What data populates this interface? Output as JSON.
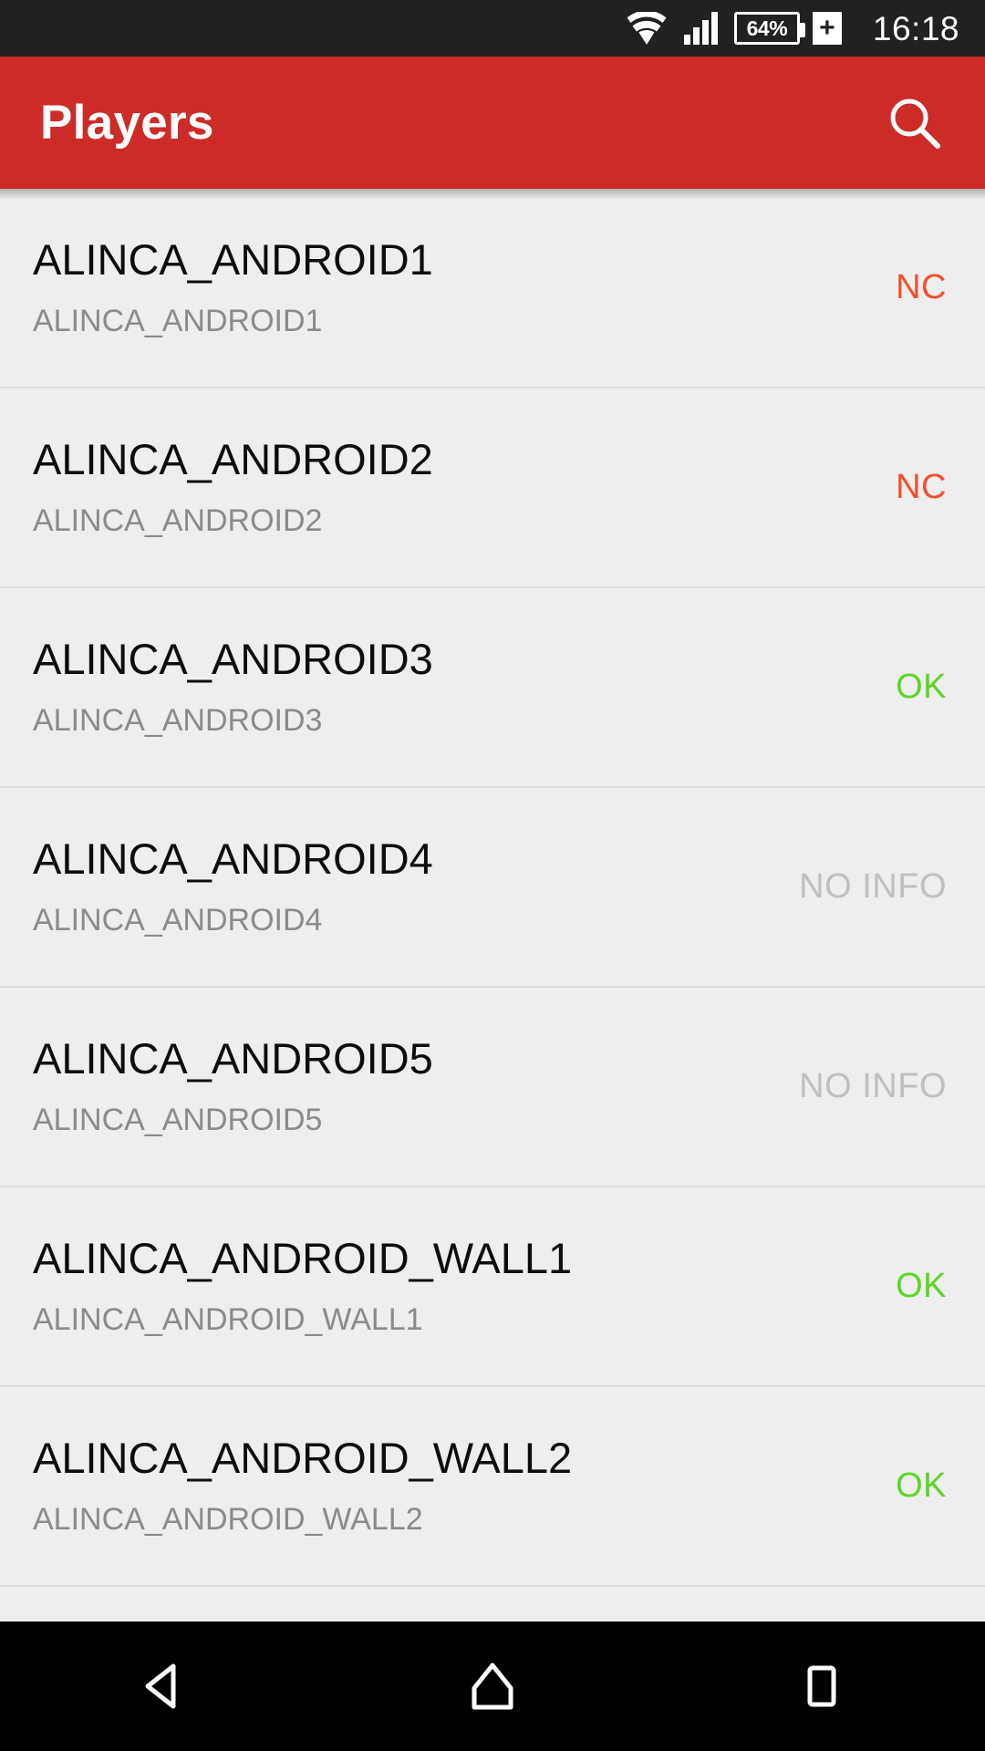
{
  "status_bar": {
    "wifi_icon": "wifi-icon",
    "signal_icon": "cellular-signal-icon",
    "battery_percent": "64%",
    "battery_plus": "+",
    "time": "16:18"
  },
  "app_bar": {
    "title": "Players",
    "search_icon": "search-icon"
  },
  "colors": {
    "app_bar": "#CC2B28",
    "status_nc": "#F2502B",
    "status_ok": "#5BD527",
    "status_no_info": "#BFBFBF",
    "list_background": "#EEEEEE",
    "divider": "#DCDCDC"
  },
  "list": {
    "items": [
      {
        "title": "ALINCA_ANDROID1",
        "subtitle": "ALINCA_ANDROID1",
        "status": "NC",
        "status_kind": "nc"
      },
      {
        "title": "ALINCA_ANDROID2",
        "subtitle": "ALINCA_ANDROID2",
        "status": "NC",
        "status_kind": "nc"
      },
      {
        "title": "ALINCA_ANDROID3",
        "subtitle": "ALINCA_ANDROID3",
        "status": "OK",
        "status_kind": "ok"
      },
      {
        "title": "ALINCA_ANDROID4",
        "subtitle": "ALINCA_ANDROID4",
        "status": "NO INFO",
        "status_kind": "noinfo"
      },
      {
        "title": "ALINCA_ANDROID5",
        "subtitle": "ALINCA_ANDROID5",
        "status": "NO INFO",
        "status_kind": "noinfo"
      },
      {
        "title": "ALINCA_ANDROID_WALL1",
        "subtitle": "ALINCA_ANDROID_WALL1",
        "status": "OK",
        "status_kind": "ok"
      },
      {
        "title": "ALINCA_ANDROID_WALL2",
        "subtitle": "ALINCA_ANDROID_WALL2",
        "status": "OK",
        "status_kind": "ok"
      }
    ]
  },
  "nav_bar": {
    "back_icon": "back-triangle-icon",
    "home_icon": "home-icon",
    "recents_icon": "recents-square-icon"
  }
}
